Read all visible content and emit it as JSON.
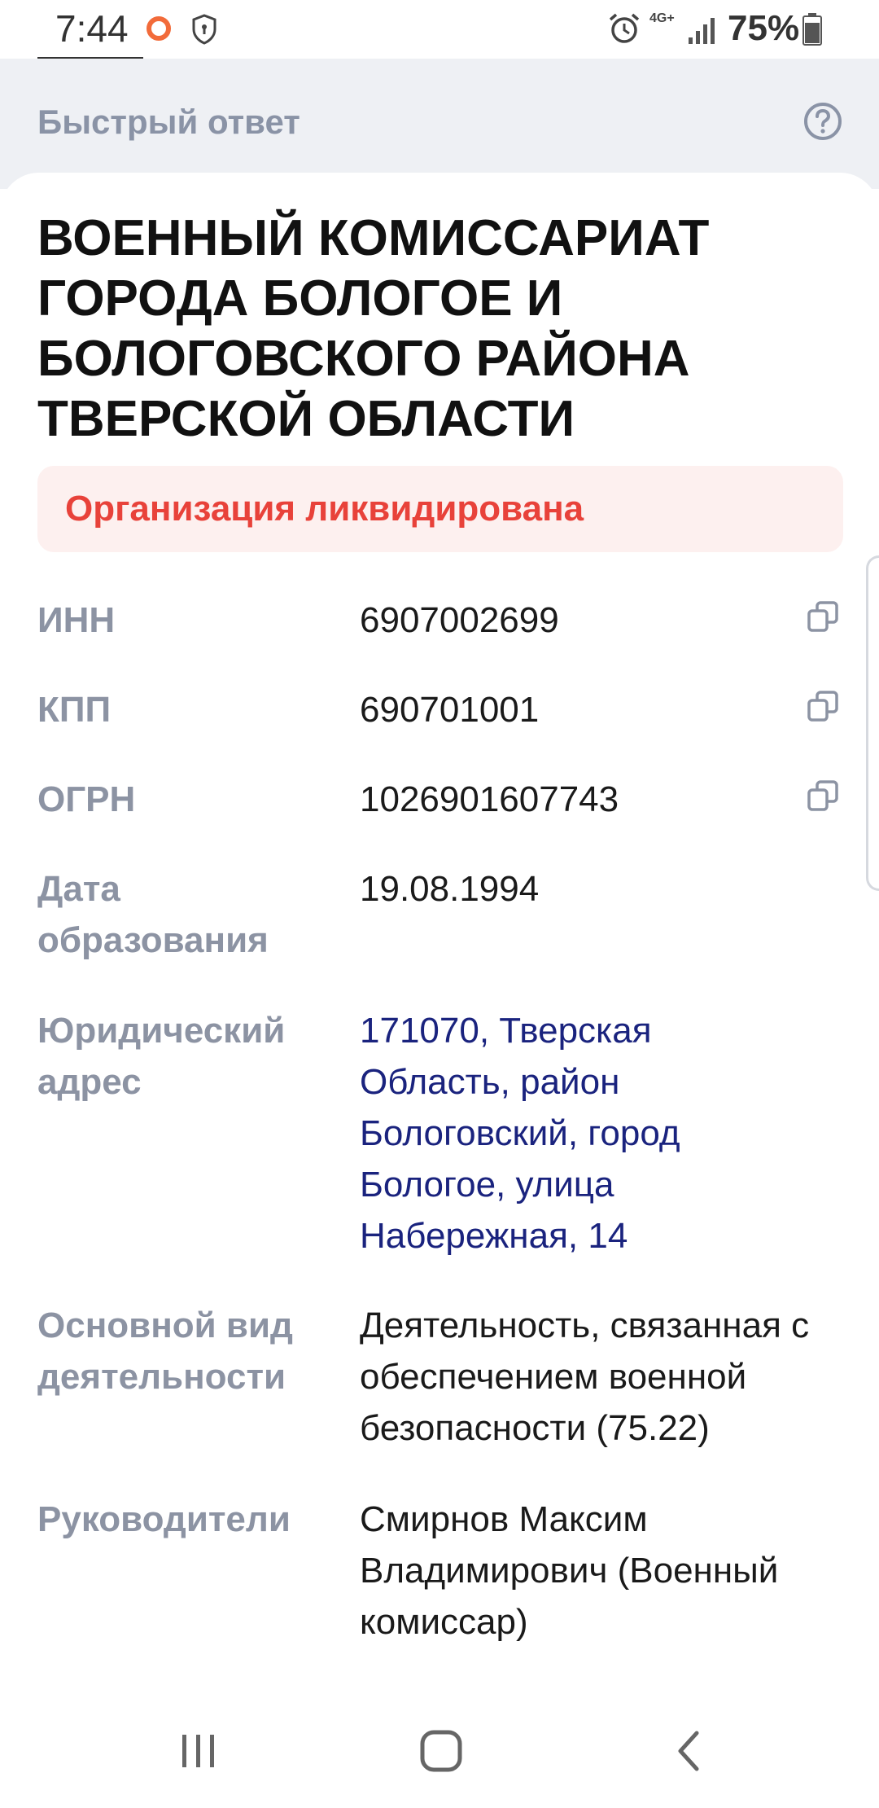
{
  "status_bar": {
    "time": "7:44",
    "network": "4G+",
    "battery": "75%"
  },
  "header": {
    "title": "Быстрый ответ",
    "help_icon": "question-circle-icon"
  },
  "organization": {
    "name": "ВОЕННЫЙ КОМИССАРИАТ ГОРОДА БОЛОГОЕ И БОЛОГОВСКОГО РАЙОНА ТВЕРСКОЙ ОБЛАСТИ",
    "status": "Организация ликвидирована",
    "status_color": "#e8423a"
  },
  "details": {
    "inn": {
      "label": "ИНН",
      "value": "6907002699"
    },
    "kpp": {
      "label": "КПП",
      "value": "690701001"
    },
    "ogrn": {
      "label": "ОГРН",
      "value": "1026901607743"
    },
    "founded": {
      "label": "Дата образования",
      "value": "19.08.1994"
    },
    "address": {
      "label": "Юридический адрес",
      "value": "171070, Тверская Область, район Бологовский, город Бологое, улица Набережная, 14"
    },
    "activity": {
      "label": "Основной вид деятельности",
      "value": "Деятельность, связанная с обеспечением военной безопасности (75.22)"
    },
    "managers": {
      "label": "Руководители",
      "value": "Смирнов Максим Владимирович (Военный комиссар)"
    }
  },
  "icons": {
    "copy": "copy-icon",
    "recent_apps": "recent-apps-icon",
    "home": "home-icon",
    "back": "back-icon"
  }
}
